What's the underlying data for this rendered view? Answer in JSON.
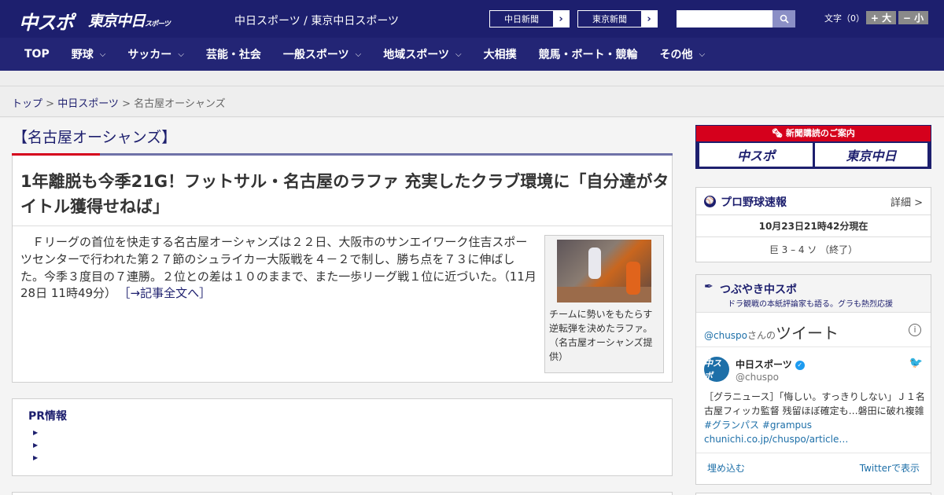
{
  "header": {
    "logo_chuspo": "中スポ",
    "logo_tokyo": "東京中日",
    "logo_tokyo_small": "スポーツ",
    "site_name": "中日スポーツ / 東京中日スポーツ",
    "paper_links": [
      "中日新聞",
      "東京新聞"
    ],
    "search_placeholder": "",
    "font_size_label": "文字（0）",
    "font_large": "+ 大",
    "font_small": "− 小"
  },
  "nav": {
    "items": [
      {
        "label": "TOP",
        "chevron": false
      },
      {
        "label": "野球",
        "chevron": true
      },
      {
        "label": "サッカー",
        "chevron": true
      },
      {
        "label": "芸能・社会",
        "chevron": false
      },
      {
        "label": "一般スポーツ",
        "chevron": true
      },
      {
        "label": "地域スポーツ",
        "chevron": true
      },
      {
        "label": "大相撲",
        "chevron": false
      },
      {
        "label": "競馬・ボート・競輪",
        "chevron": false
      },
      {
        "label": "その他",
        "chevron": true
      }
    ]
  },
  "breadcrumb": {
    "home": "トップ",
    "sep": " > ",
    "section": "中日スポーツ",
    "current": "名古屋オーシャンズ"
  },
  "section_title": "【名古屋オーシャンズ】",
  "article": {
    "headline": "1年離脱も今季21G！フットサル・名古屋のラファ 充実したクラブ環境に「自分達がタイトル獲得せねば」",
    "body": "Ｆリーグの首位を快走する名古屋オーシャンズは２２日、大阪市のサンエイワーク住吉スポーツセンターで行われた第２７節のシュライカー大阪戦を４－２で制し、勝ち点を７３に伸ばした。今季３度目の７連勝。２位との差は１０のままで、また一歩リーグ戦１位に近づいた。（11月28日 11時49分）",
    "more_link": "［→記事全文へ］",
    "photo_caption": "チームに勢いをもたらす逆転弾を決めたラファ。（名古屋オーシャンズ提供）"
  },
  "pr": {
    "title": "PR情報",
    "bullets": [
      "",
      "",
      ""
    ]
  },
  "sidebar": {
    "subscription": {
      "title": "新聞購読のご案内",
      "logo1": "中スポ",
      "logo2": "東京中日"
    },
    "baseball": {
      "title": "プロ野球速報",
      "detail": "詳細 >",
      "time": "10月23日21時42分現在",
      "score": "巨 3 – 4 ソ （終了）"
    },
    "twitter": {
      "title": "つぶやき中スポ",
      "subtitle": "ドラ観戦の本紙評論家も語る。グラも熱烈応援",
      "handle_prefix": "@chuspo",
      "handle_mid": "さんの",
      "handle_suffix": "ツイート",
      "account_name": "中日スポーツ",
      "account_user": "@chuspo",
      "avatar_text": "中スポ",
      "tweet_text": "［グラニュース］「悔しい。すっきりしない」Ｊ１名古屋フィッカ監督 残留ほぼ確定も…磐田に破れ複雑",
      "tweet_tags": "#グランパス #grampus",
      "tweet_url": "chunichi.co.jp/chuspo/article…",
      "embed": "埋め込む",
      "view": "Twitterで表示"
    }
  },
  "colors": {
    "brand_navy": "#1d1f6e",
    "accent_red": "#d5001c",
    "link_blue": "#1d6fa8"
  }
}
